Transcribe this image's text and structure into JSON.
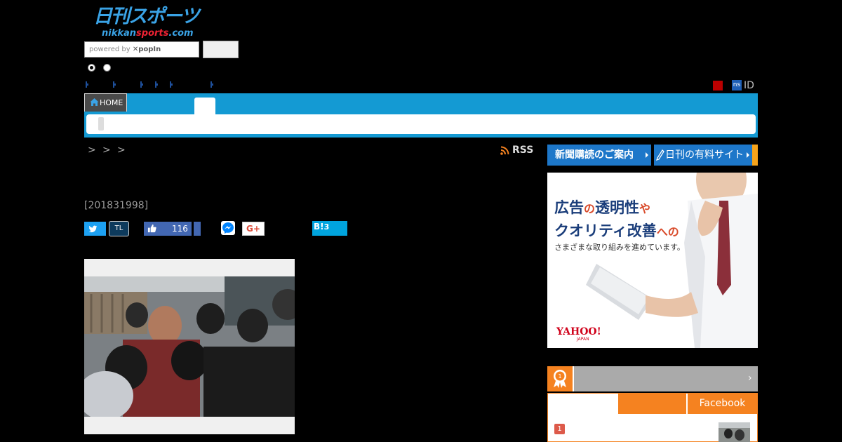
{
  "header": {
    "logo_main": "日刊スポーツ",
    "logo_sub_a": "nikkan",
    "logo_sub_b": "sports",
    "logo_sub_c": ".com",
    "search": {
      "powered_by": "powered by ",
      "brand": "✕popIn",
      "button_label": ""
    },
    "user": {
      "ns_badge": "ns",
      "id_label": "ID"
    }
  },
  "nav": {
    "home_label": "HOME"
  },
  "breadcrumb": {
    "separators": [
      ">",
      ">",
      ">"
    ],
    "rss_label": "RSS"
  },
  "article": {
    "date_code": "[201831998]",
    "share": {
      "tl_label": "TL",
      "fb_count": "116",
      "gplus_label": "G+",
      "hatena_label": "B!",
      "hatena_count": "3"
    }
  },
  "sidebar": {
    "subscribe_label": "新聞購読のご案内",
    "paid_site_label": "日刊の有料サイト",
    "ad": {
      "line1_a": "広告",
      "line1_b": "の",
      "line1_c": "透明性",
      "line1_d": "や",
      "line2_a": "クオリティ改善",
      "line2_b": "への",
      "line3": "さまざまな取り組みを進めています。",
      "logo": "YAHOO!",
      "logo_sub": "JAPAN"
    },
    "ranking": {
      "tab_facebook": "Facebook",
      "first_rank": "1",
      "chevron": "›"
    }
  },
  "colors": {
    "nav_blue": "#149ad3",
    "sidebar_blue": "#1d77c9",
    "orange": "#f58220",
    "twitter": "#1da1f2",
    "facebook": "#4267b2",
    "hatena": "#00a4de"
  }
}
